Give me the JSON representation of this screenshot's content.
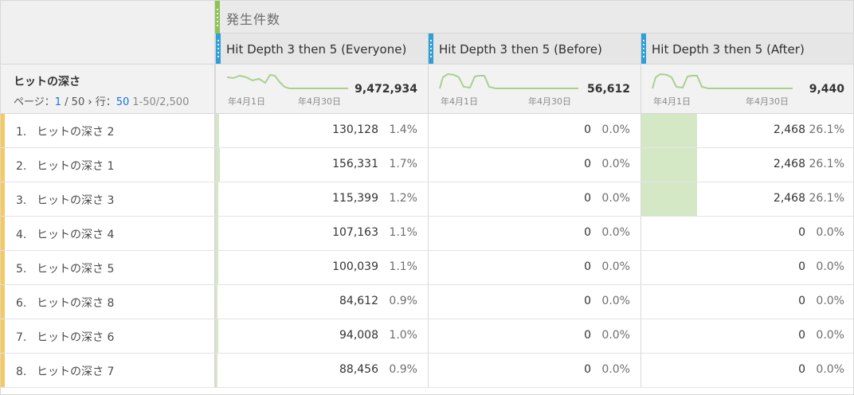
{
  "metric": {
    "label": "発生件数"
  },
  "segments": [
    {
      "label": "Hit Depth 3 then 5 (Everyone)",
      "total": "9,472,934",
      "start_date": "年4月1日",
      "end_date": "年4月30日"
    },
    {
      "label": "Hit Depth 3 then 5 (Before)",
      "total": "56,612",
      "start_date": "年4月1日",
      "end_date": "年4月30日"
    },
    {
      "label": "Hit Depth 3 then 5 (After)",
      "total": "9,440",
      "start_date": "年4月1日",
      "end_date": "年4月30日"
    }
  ],
  "dimension": {
    "title": "ヒットの深さ",
    "page_label": "ページ：",
    "page_current": "1",
    "page_sep": " / 50",
    "page_next": " › ",
    "rows_label": "行：",
    "rows_value": "50",
    "range": "1-50/2,500"
  },
  "rows": [
    {
      "index": "1.",
      "name": "ヒットの深さ 2",
      "cells": [
        {
          "value": "130,128",
          "pct": "1.4%",
          "share": 0.014
        },
        {
          "value": "0",
          "pct": "0.0%",
          "share": 0
        },
        {
          "value": "2,468",
          "pct": "26.1%",
          "share": 0.261
        }
      ]
    },
    {
      "index": "2.",
      "name": "ヒットの深さ 1",
      "cells": [
        {
          "value": "156,331",
          "pct": "1.7%",
          "share": 0.017
        },
        {
          "value": "0",
          "pct": "0.0%",
          "share": 0
        },
        {
          "value": "2,468",
          "pct": "26.1%",
          "share": 0.261
        }
      ]
    },
    {
      "index": "3.",
      "name": "ヒットの深さ 3",
      "cells": [
        {
          "value": "115,399",
          "pct": "1.2%",
          "share": 0.012
        },
        {
          "value": "0",
          "pct": "0.0%",
          "share": 0
        },
        {
          "value": "2,468",
          "pct": "26.1%",
          "share": 0.261
        }
      ]
    },
    {
      "index": "4.",
      "name": "ヒットの深さ 4",
      "cells": [
        {
          "value": "107,163",
          "pct": "1.1%",
          "share": 0.011
        },
        {
          "value": "0",
          "pct": "0.0%",
          "share": 0
        },
        {
          "value": "0",
          "pct": "0.0%",
          "share": 0
        }
      ]
    },
    {
      "index": "5.",
      "name": "ヒットの深さ 5",
      "cells": [
        {
          "value": "100,039",
          "pct": "1.1%",
          "share": 0.011
        },
        {
          "value": "0",
          "pct": "0.0%",
          "share": 0
        },
        {
          "value": "0",
          "pct": "0.0%",
          "share": 0
        }
      ]
    },
    {
      "index": "6.",
      "name": "ヒットの深さ 8",
      "cells": [
        {
          "value": "84,612",
          "pct": "0.9%",
          "share": 0.009
        },
        {
          "value": "0",
          "pct": "0.0%",
          "share": 0
        },
        {
          "value": "0",
          "pct": "0.0%",
          "share": 0
        }
      ]
    },
    {
      "index": "7.",
      "name": "ヒットの深さ 6",
      "cells": [
        {
          "value": "94,008",
          "pct": "1.0%",
          "share": 0.01
        },
        {
          "value": "0",
          "pct": "0.0%",
          "share": 0
        },
        {
          "value": "0",
          "pct": "0.0%",
          "share": 0
        }
      ]
    },
    {
      "index": "8.",
      "name": "ヒットの深さ 7",
      "cells": [
        {
          "value": "88,456",
          "pct": "0.9%",
          "share": 0.009
        },
        {
          "value": "0",
          "pct": "0.0%",
          "share": 0
        },
        {
          "value": "0",
          "pct": "0.0%",
          "share": 0
        }
      ]
    }
  ],
  "colors": {
    "metric_handle": "#8fc255",
    "segment_handle": "#2e9fd8",
    "row_accent": "#f5c95d",
    "bar_fill": "#d4e8c6",
    "sparkline": "#a9d18e",
    "link_blue": "#1473e6"
  }
}
